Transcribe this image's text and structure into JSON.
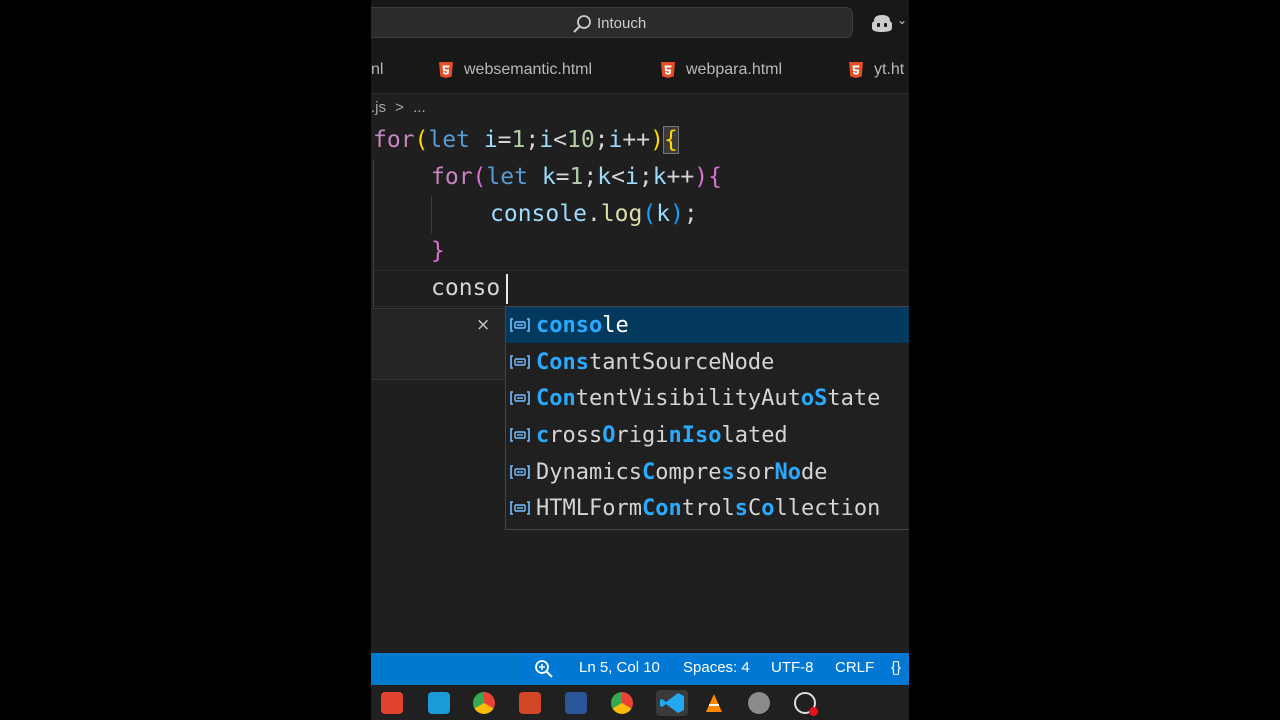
{
  "titlebar": {
    "search_text": "Intouch"
  },
  "tabs": [
    {
      "label": "nl"
    },
    {
      "label": "websemantic.html"
    },
    {
      "label": "webpara.html"
    },
    {
      "label": "yt.ht"
    }
  ],
  "breadcrumb": {
    "file": ".js",
    "separator": ">",
    "rest": "..."
  },
  "editor": {
    "typed": "conso"
  },
  "suggest": {
    "close": "×",
    "items": [
      {
        "label": "console",
        "selected": true
      },
      {
        "label": "ConstantSourceNode"
      },
      {
        "label": "ContentVisibilityAutoState"
      },
      {
        "label": "crossOriginIsolated"
      },
      {
        "label": "DynamicsCompressorNode"
      },
      {
        "label": "HTMLFormControlsCollection"
      }
    ]
  },
  "statusbar": {
    "position": "Ln 5, Col 10",
    "spaces": "Spaces: 4",
    "encoding": "UTF-8",
    "eol": "CRLF",
    "lang_brace": "{}"
  },
  "colors": {
    "status_bar": "#0078d4",
    "selected_suggestion": "#04395e",
    "match_highlight": "#2aaaff",
    "html_icon": "#e44d26"
  }
}
